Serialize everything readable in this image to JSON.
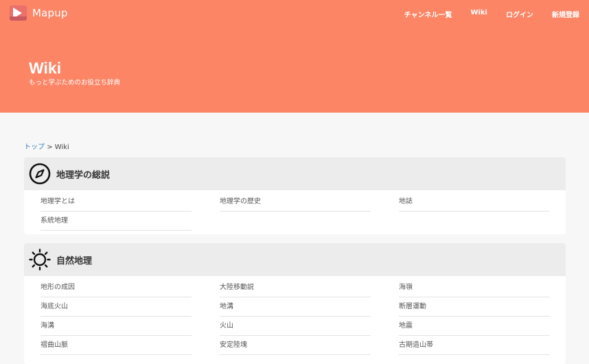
{
  "header": {
    "brand": "Mapup",
    "nav": [
      "チャンネル一覧",
      "Wiki",
      "ログイン",
      "新規登録"
    ]
  },
  "hero": {
    "title": "Wiki",
    "subtitle": "もっと学ぶためのお役立ち辞典"
  },
  "breadcrumb": {
    "home": "トップ",
    "separator": ">",
    "current": "Wiki"
  },
  "sections": [
    {
      "icon": "compass-icon",
      "title": "地理学の総説",
      "items": [
        "地理学とは",
        "地理学の歴史",
        "地誌",
        "系統地理"
      ]
    },
    {
      "icon": "sun-icon",
      "title": "自然地理",
      "items": [
        "地形の成因",
        "大陸移動説",
        "海嶺",
        "海底火山",
        "地溝",
        "断層運動",
        "海溝",
        "火山",
        "地震",
        "褶曲山脈",
        "安定陸塊",
        "古期造山帯"
      ]
    }
  ],
  "colors": {
    "hero_bg": "#fc8566",
    "link": "#3a7fc3",
    "section_head_bg": "#ececec"
  }
}
